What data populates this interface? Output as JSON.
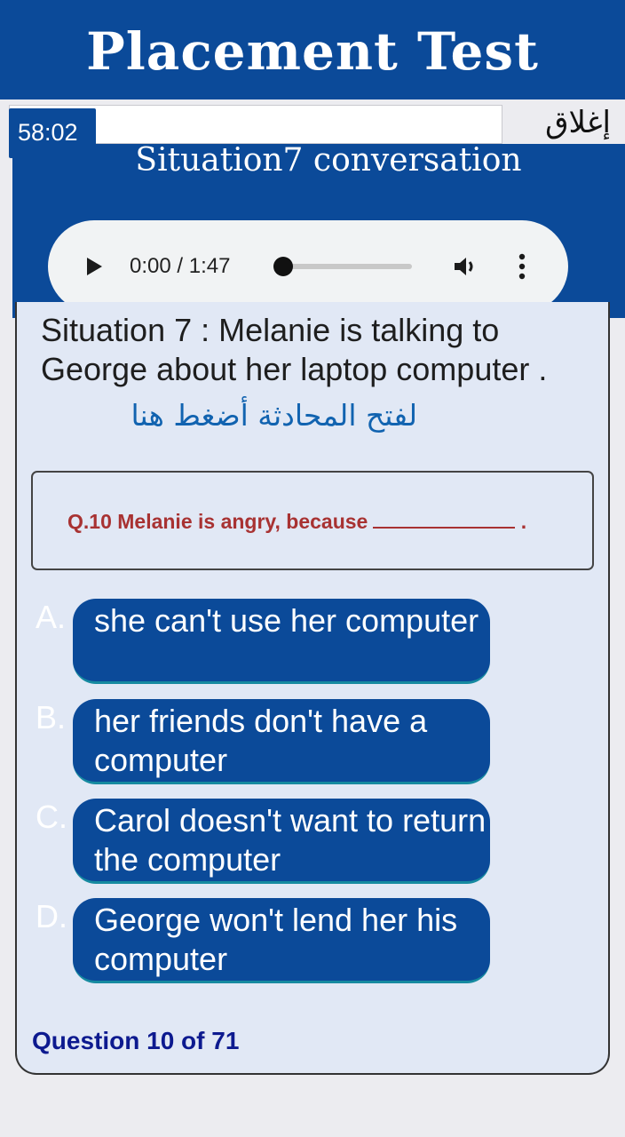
{
  "header": {
    "title": "Placement Test"
  },
  "status": {
    "timer": "58:02",
    "close_label": "إغلاق"
  },
  "situation": {
    "title": "Situation7 conversation",
    "description": "Situation 7 : Melanie is talking to George about her laptop computer .",
    "open_link": "لفتح المحادثة أضغط هنا"
  },
  "audio": {
    "time": "0:00 / 1:47",
    "progress": 0
  },
  "question": {
    "text": "Q.10 Melanie is angry, because",
    "end_mark": "."
  },
  "options": [
    {
      "letter": "A.",
      "label": "she can't use her computer"
    },
    {
      "letter": "B.",
      "label": "her friends don't have a computer"
    },
    {
      "letter": "C.",
      "label": "Carol doesn't want to return the computer"
    },
    {
      "letter": "D.",
      "label": "George won't lend her his computer"
    }
  ],
  "footer": {
    "counter": "Question 10 of 71"
  },
  "colors": {
    "primary": "#0b4a99",
    "question": "#a83232",
    "card": "#e1e8f5",
    "counter": "#0d1a8f",
    "link": "#1163b0"
  }
}
